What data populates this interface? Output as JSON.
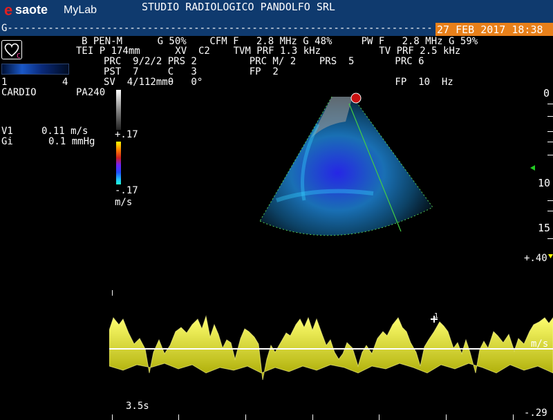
{
  "header": {
    "logo_e": "e",
    "logo_saote": "saote",
    "logo_mylab": "MyLab",
    "studio": "STUDIO RADIOLOGICO PANDOLFO SRL",
    "gline": "G-------------------------------------------------------------------------",
    "date": "27 FEB 2017 18:38"
  },
  "params": {
    "row1": "B PEN-M      G 50%    CFM F   2.8 MHz G 48%     PW F   2.8 MHz G 59%",
    "row2": "TEI P 174mm      XV  C2    TVM PRF 1.3 kHz          TV PRF 2.5 kHz",
    "row3": "PRC  9/2/2 PRS 2         PRC M/ 2    PRS  5       PRC 6",
    "row4": "PST  7     C   3         FP  2",
    "row5": "SV  4/112mmθ   0°                                 FP  10  Hz"
  },
  "left": {
    "heart_label": "C",
    "scale_min": "1",
    "scale_max": "4",
    "preset": "CARDIO",
    "probe": "PA240",
    "v1_label": "V1",
    "v1_value": "0.11 m/s",
    "gi_label": "Gi",
    "gi_value": "0.1 mmHg"
  },
  "colorbar": {
    "top": "+.17",
    "bottom": "-.17",
    "unit": "m/s"
  },
  "depth": {
    "d0": "0",
    "d10": "10",
    "d15": "15"
  },
  "doppler": {
    "top": "+.40",
    "unit": "m/s",
    "bottom": "-.29",
    "time": "3.5s",
    "cursor_label": "1"
  }
}
